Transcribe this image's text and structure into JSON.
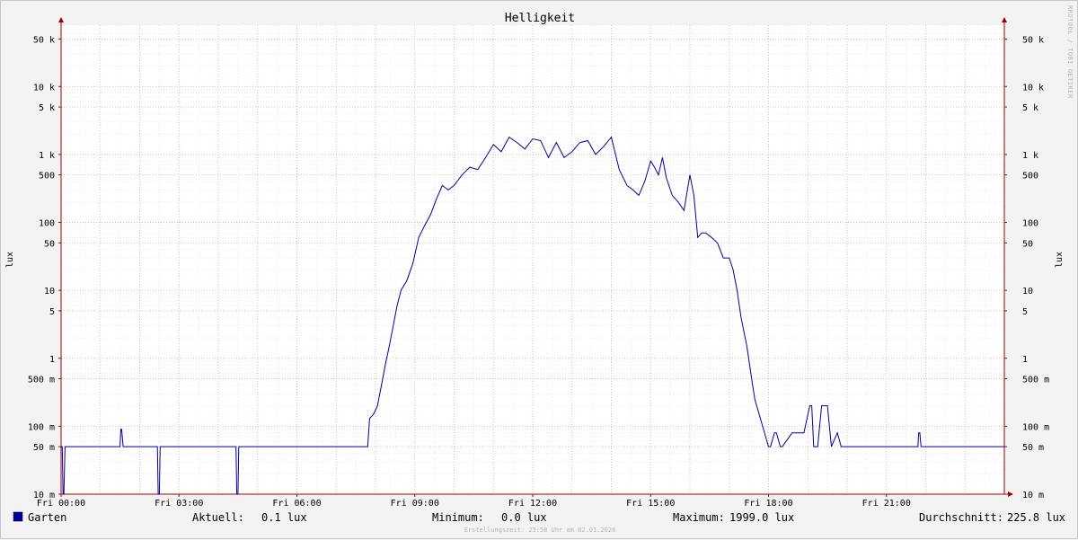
{
  "chart_data": {
    "type": "line",
    "title": "Helligkeit",
    "ylabel": "lux",
    "ylabel_right": "lux",
    "y_scale": "log",
    "ylim": [
      0.01,
      80000
    ],
    "y_ticks": [
      {
        "value": 0.01,
        "label": "10 m"
      },
      {
        "value": 0.05,
        "label": "50 m"
      },
      {
        "value": 0.1,
        "label": "100 m"
      },
      {
        "value": 0.5,
        "label": "500 m"
      },
      {
        "value": 1,
        "label": "1"
      },
      {
        "value": 5,
        "label": "5"
      },
      {
        "value": 10,
        "label": "10"
      },
      {
        "value": 50,
        "label": "50"
      },
      {
        "value": 100,
        "label": "100"
      },
      {
        "value": 500,
        "label": "500"
      },
      {
        "value": 1000,
        "label": "1 k"
      },
      {
        "value": 5000,
        "label": "5 k"
      },
      {
        "value": 10000,
        "label": "10 k"
      },
      {
        "value": 50000,
        "label": "50 k"
      }
    ],
    "x_unit": "hours",
    "xlim": [
      0,
      24
    ],
    "x_ticks": [
      {
        "value": 0,
        "label": "Fri 00:00"
      },
      {
        "value": 3,
        "label": "Fri 03:00"
      },
      {
        "value": 6,
        "label": "Fri 06:00"
      },
      {
        "value": 9,
        "label": "Fri 09:00"
      },
      {
        "value": 12,
        "label": "Fri 12:00"
      },
      {
        "value": 15,
        "label": "Fri 15:00"
      },
      {
        "value": 18,
        "label": "Fri 18:00"
      },
      {
        "value": 21,
        "label": "Fri 21:00"
      }
    ],
    "grid": true,
    "series": [
      {
        "name": "Garten",
        "color": "#00009c",
        "x": [
          0,
          0.03,
          0.05,
          0.07,
          0.1,
          0.12,
          1.5,
          1.52,
          1.54,
          1.58,
          2.45,
          2.47,
          2.5,
          2.52,
          4.45,
          4.47,
          4.5,
          4.52,
          7.8,
          7.85,
          7.95,
          8.05,
          8.15,
          8.25,
          8.35,
          8.45,
          8.55,
          8.65,
          8.8,
          8.95,
          9.1,
          9.25,
          9.4,
          9.55,
          9.7,
          9.85,
          10.0,
          10.2,
          10.4,
          10.6,
          10.8,
          11.0,
          11.2,
          11.4,
          11.6,
          11.8,
          12.0,
          12.2,
          12.4,
          12.6,
          12.8,
          13.0,
          13.2,
          13.4,
          13.6,
          13.8,
          14.0,
          14.2,
          14.4,
          14.55,
          14.7,
          14.85,
          15.0,
          15.1,
          15.2,
          15.3,
          15.4,
          15.55,
          15.7,
          15.85,
          16.0,
          16.1,
          16.2,
          16.3,
          16.4,
          16.55,
          16.7,
          16.85,
          17.0,
          17.1,
          17.2,
          17.3,
          17.45,
          17.55,
          17.65,
          18.0,
          18.05,
          18.15,
          18.2,
          18.3,
          18.35,
          18.6,
          18.7,
          18.9,
          19.05,
          19.1,
          19.15,
          19.25,
          19.35,
          19.5,
          19.6,
          19.75,
          19.85,
          19.9,
          21.8,
          21.82,
          21.85,
          21.88,
          24
        ],
        "y": [
          0.05,
          0.05,
          0.01,
          0.01,
          0.05,
          0.05,
          0.05,
          0.09,
          0.09,
          0.05,
          0.05,
          0.01,
          0.01,
          0.05,
          0.05,
          0.01,
          0.01,
          0.05,
          0.05,
          0.13,
          0.15,
          0.2,
          0.4,
          0.8,
          1.5,
          3,
          6,
          10,
          14,
          25,
          60,
          90,
          130,
          220,
          350,
          300,
          350,
          500,
          650,
          600,
          900,
          1400,
          1100,
          1800,
          1500,
          1200,
          1700,
          1600,
          900,
          1500,
          900,
          1100,
          1500,
          1600,
          1000,
          1300,
          1800,
          600,
          350,
          300,
          250,
          400,
          800,
          650,
          500,
          900,
          450,
          250,
          200,
          150,
          500,
          250,
          60,
          70,
          70,
          60,
          50,
          30,
          30,
          20,
          10,
          4,
          1.5,
          0.6,
          0.25,
          0.05,
          0.05,
          0.08,
          0.08,
          0.05,
          0.05,
          0.08,
          0.08,
          0.08,
          0.2,
          0.2,
          0.05,
          0.05,
          0.2,
          0.2,
          0.05,
          0.08,
          0.05,
          0.05,
          0.05,
          0.08,
          0.08,
          0.05,
          0.05
        ]
      }
    ]
  },
  "legend": {
    "series_name": "Garten",
    "series_color": "#00009c",
    "current_label": "Aktuell:",
    "current_value": "0.1 lux",
    "min_label": "Minimum:",
    "min_value": "0.0 lux",
    "max_label": "Maximum:",
    "max_value": "1999.0 lux",
    "avg_label": "Durchschnitt:",
    "avg_value": "225.8 lux"
  },
  "footnote": "Erstellungszeit: 23:58 Uhr am 02.01.2026",
  "watermark": "RRDTOOL / TOBI OETIKER",
  "colors": {
    "canvas": "#ffffff",
    "grid_minor": "#dcdcdc",
    "grid_major": "#e8a0a0",
    "axis": "#a00000",
    "text": "#000000"
  }
}
